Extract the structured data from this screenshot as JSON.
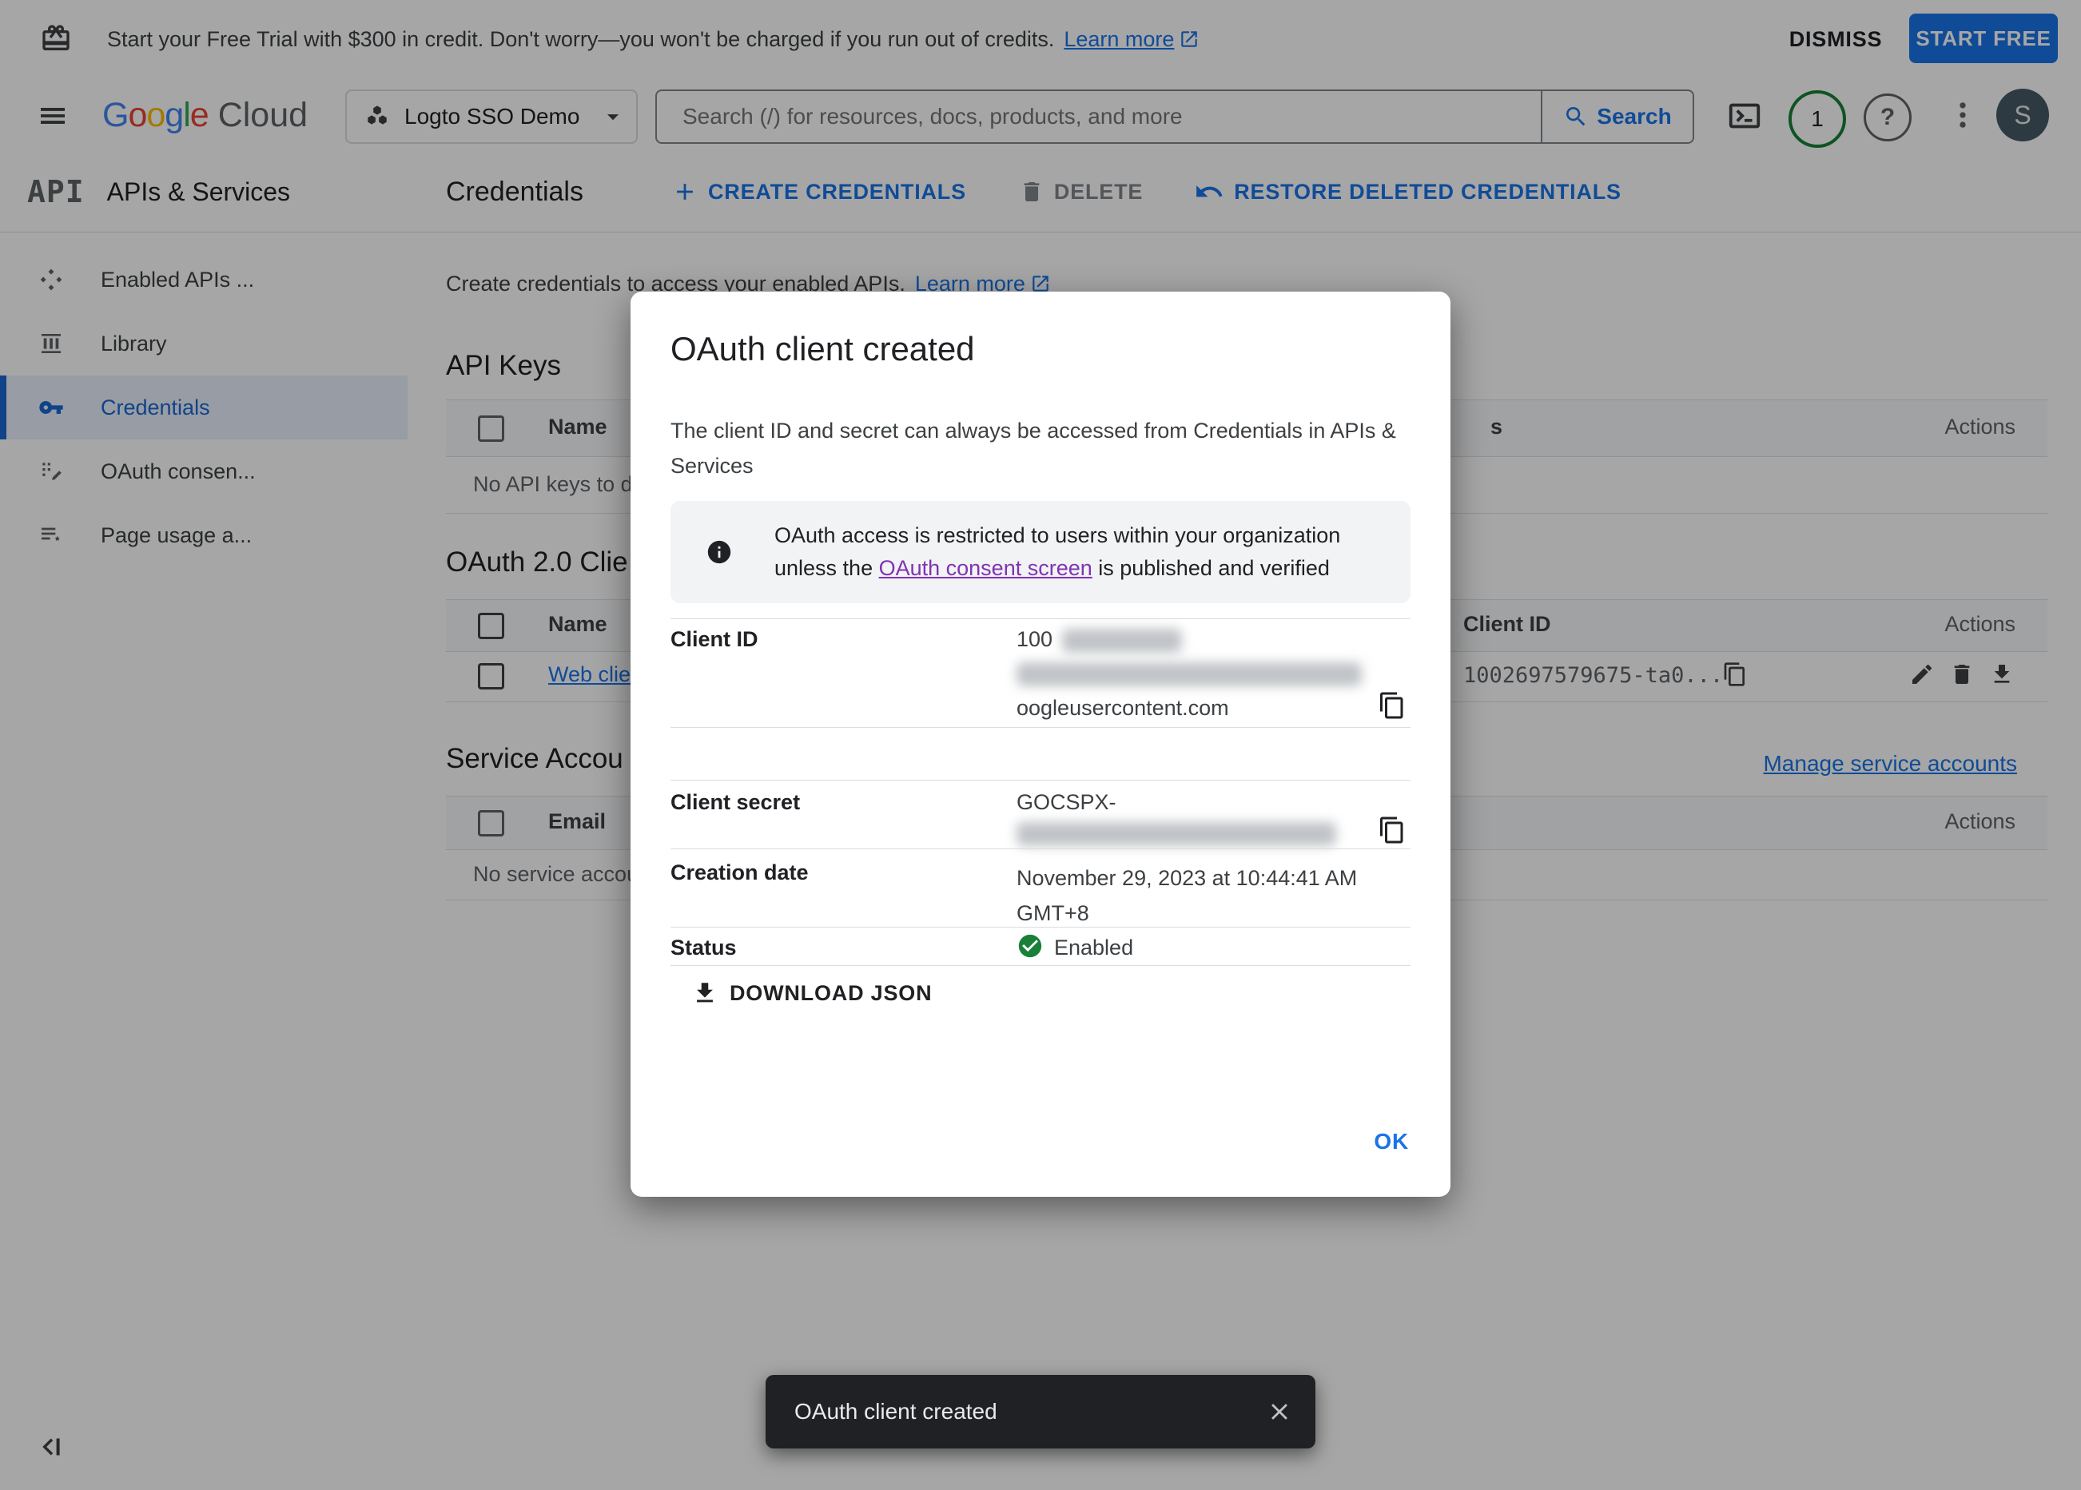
{
  "colors": {
    "accent_blue": "#1a73e8",
    "selected_blue": "#1967d2",
    "selected_bg": "#e8f0fe",
    "text_primary": "#202124",
    "text_secondary": "#5f6368",
    "border": "#dadce0",
    "green": "#188038",
    "visited_purple": "#8133b4",
    "toast_bg": "#202124",
    "avatar_bg": "#455a64",
    "info_box_bg": "#f1f3f4"
  },
  "banner": {
    "message": "Start your Free Trial with $300 in credit. Don't worry—you won't be charged if you run out of credits.",
    "learn_more": "Learn more",
    "dismiss": "DISMISS",
    "start_free": "START FREE"
  },
  "header": {
    "logo_letters": [
      "G",
      "o",
      "o",
      "g",
      "l",
      "e"
    ],
    "logo_cloud": "Cloud",
    "project_name": "Logto SSO Demo",
    "search_placeholder": "Search (/) for resources, docs, products, and more",
    "search_button": "Search",
    "notification_count": "1",
    "help_glyph": "?",
    "avatar_initial": "S"
  },
  "sidebar": {
    "product_icon": "API",
    "title": "APIs & Services",
    "items": [
      {
        "label": "Enabled APIs ..."
      },
      {
        "label": "Library"
      },
      {
        "label": "Credentials"
      },
      {
        "label": "OAuth consen..."
      },
      {
        "label": "Page usage a..."
      }
    ]
  },
  "toolbar": {
    "title": "Credentials",
    "create": "CREATE CREDENTIALS",
    "delete": "DELETE",
    "restore": "RESTORE DELETED CREDENTIALS"
  },
  "main": {
    "intro_text": "Create credentials to access your enabled APIs.",
    "intro_link": "Learn more",
    "api_keys": {
      "title": "API Keys",
      "col_name": "Name",
      "col_partial": "s",
      "col_actions": "Actions",
      "empty": "No API keys to di"
    },
    "oauth": {
      "title": "OAuth 2.0 Clie",
      "col_name": "Name",
      "col_client_id": "Client ID",
      "col_actions": "Actions",
      "row_name": "Web clie",
      "row_client_id": "1002697579675-ta0..."
    },
    "service_accounts": {
      "title": "Service Accou",
      "manage_link": "Manage service accounts",
      "col_email": "Email",
      "col_actions": "Actions",
      "empty": "No service accou"
    }
  },
  "dialog": {
    "title": "OAuth client created",
    "body_line1": "The client ID and secret can always be accessed from Credentials in APIs &",
    "body_line2": "Services",
    "notice_line1": "OAuth access is restricted to users within your organization",
    "notice_line2_pre": "unless the ",
    "notice_link": "OAuth consent screen",
    "notice_line2_post": " is published and verified",
    "client_id_label": "Client ID",
    "client_id_prefix": "100",
    "client_id_domain": "oogleusercontent.com",
    "client_secret_label": "Client secret",
    "client_secret_prefix": "GOCSPX-",
    "creation_label": "Creation date",
    "creation_line1": "November 29, 2023 at 10:44:41 AM",
    "creation_line2": "GMT+8",
    "status_label": "Status",
    "status_value": "Enabled",
    "download": "DOWNLOAD JSON",
    "ok": "OK"
  },
  "toast": {
    "message": "OAuth client created"
  }
}
